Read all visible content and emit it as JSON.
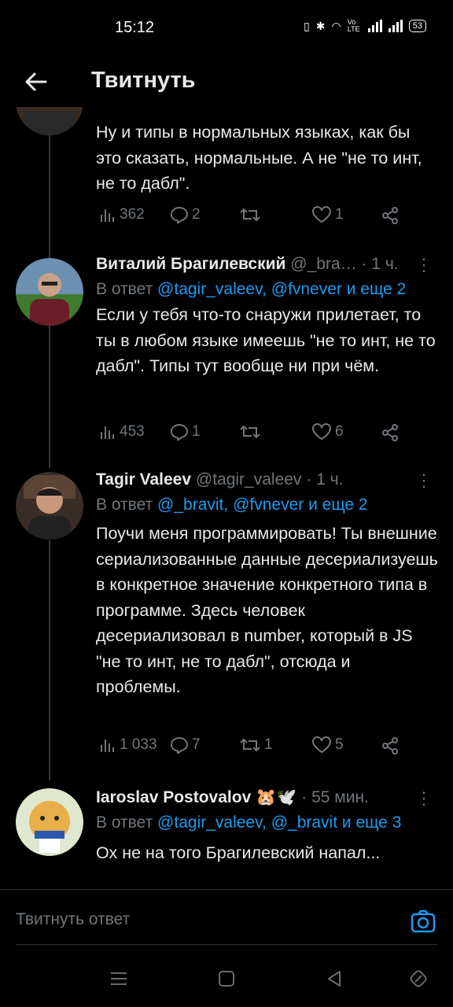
{
  "status_bar": {
    "time": "15:12",
    "network_label": "Vo LTE",
    "battery": "53"
  },
  "header": {
    "title": "Твитнуть"
  },
  "tweets": [
    {
      "text": "Ну и типы в нормальных языках, как бы это сказать, нормальные. А не \"не то инт, не то дабл\".",
      "views": "362",
      "replies": "2",
      "retweets": "",
      "likes": "1"
    },
    {
      "name": "Виталий Брагилевский",
      "handle": "@_bra…",
      "time": "· 1 ч.",
      "reply_prefix": "В ответ",
      "mentions": "@tagir_valeev, @fvnever и еще 2",
      "text": "Если у тебя что-то снаружи прилетает, то ты в любом языке имеешь \"не то инт, не то дабл\". Типы тут вообще ни при чём.",
      "views": "453",
      "replies": "1",
      "retweets": "",
      "likes": "6"
    },
    {
      "name": "Tagir Valeev",
      "handle": "@tagir_valeev",
      "time": "· 1 ч.",
      "reply_prefix": "В ответ",
      "mentions": "@_bravit, @fvnever и еще 2",
      "text": "Поучи меня программировать! Ты внешние сериализованные данные десериализуешь в конкретное значение конкретного типа в программе. Здесь человек десериализовал в number, который в JS \"не то инт, не то дабл\", отсюда и проблемы.",
      "views": "1 033",
      "replies": "7",
      "retweets": "1",
      "likes": "5"
    },
    {
      "name": "Iaroslav Postovalov",
      "emoji": "🐹🕊️",
      "time": "· 55 мин.",
      "reply_prefix": "В ответ",
      "mentions": "@tagir_valeev, @_bravit и еще 3",
      "text": "Ох не на того Брагилевский напал..."
    }
  ],
  "reply_box": {
    "placeholder": "Твитнуть ответ"
  },
  "colors": {
    "accent": "#1d9bf0",
    "background": "#000000",
    "text": "#e7e9ea",
    "muted": "#71767b"
  }
}
